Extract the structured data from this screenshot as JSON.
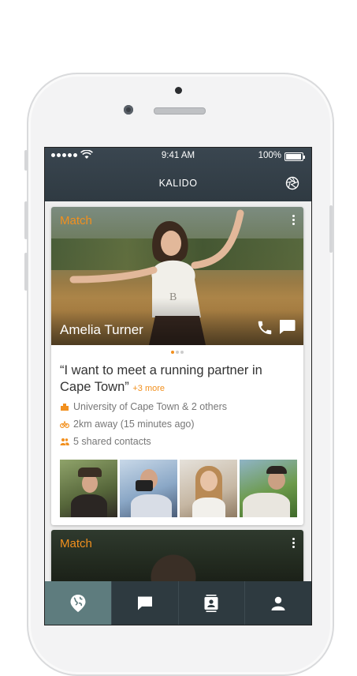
{
  "status_bar": {
    "time": "9:41 AM",
    "battery": "100%"
  },
  "header": {
    "title": "KALIDO",
    "action_icon": "aperture-icon"
  },
  "cards": [
    {
      "label": "Match",
      "name": "Amelia Turner",
      "quote": "“I want to meet a running partner in Cape Town”",
      "more": "+3 more",
      "details": [
        {
          "icon": "building-icon",
          "text": "University of Cape Town & 2 others"
        },
        {
          "icon": "bicycle-icon",
          "text": "2km away (15 minutes ago)"
        },
        {
          "icon": "people-icon",
          "text": "5 shared contacts"
        }
      ],
      "page_indicator": {
        "count": 3,
        "active": 1
      }
    },
    {
      "label": "Match"
    }
  ],
  "tabs": [
    {
      "icon": "globe-pin-icon",
      "active": true
    },
    {
      "icon": "chat-icon",
      "active": false
    },
    {
      "icon": "contacts-icon",
      "active": false
    },
    {
      "icon": "profile-icon",
      "active": false
    }
  ],
  "colors": {
    "accent": "#f2901e",
    "header_bg": "#34404a",
    "tabbar_bg": "#2e3a40",
    "tab_active": "#5e7c7e"
  }
}
